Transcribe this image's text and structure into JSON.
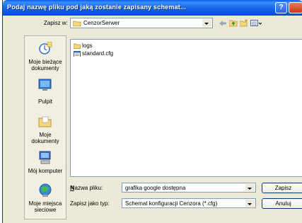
{
  "dialog": {
    "title": "Podaj nazwę pliku pod jaką zostanie zapisany schemat...",
    "help_label": "?"
  },
  "save_in": {
    "label": "Zapisz w:",
    "value": "CenzorSerwer"
  },
  "places": [
    {
      "label": "Moje bieżące dokumenty",
      "icon": "recent-documents-icon"
    },
    {
      "label": "Pulpit",
      "icon": "desktop-icon"
    },
    {
      "label": "Moje dokumenty",
      "icon": "my-documents-folder-icon"
    },
    {
      "label": "Mój komputer",
      "icon": "my-computer-icon"
    },
    {
      "label": "Moje miejsca sieciowe",
      "icon": "network-places-icon"
    }
  ],
  "files": [
    {
      "name": "logs",
      "icon": "folder-icon"
    },
    {
      "name": "standard.cfg",
      "icon": "config-file-icon"
    }
  ],
  "filename": {
    "label": "Nazwa pliku:",
    "value": "grafika google dostępna"
  },
  "filetype": {
    "label": "Zapisz jako typ:",
    "value": "Schemat konfiguracji Cenzora (*.cfg)"
  },
  "buttons": {
    "save": "Zapisz",
    "cancel": "Anuluj"
  },
  "colors": {
    "title_bar": "#0A5FE8",
    "dialog_bg": "#ECE9D8",
    "accent_border": "#7F9DB9"
  }
}
